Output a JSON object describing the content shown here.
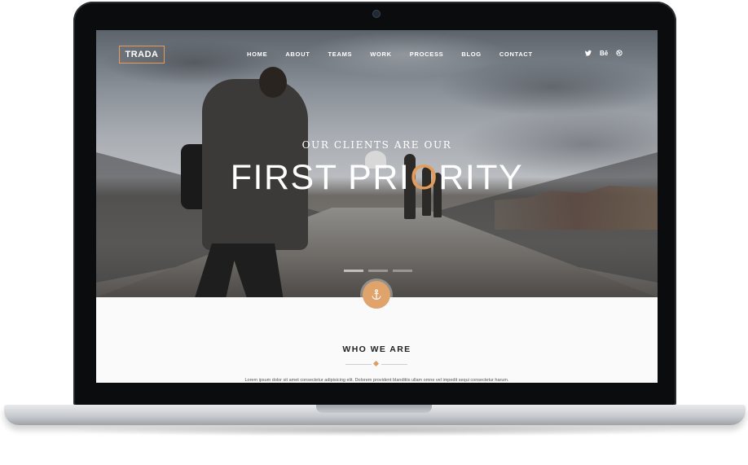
{
  "site": {
    "logo": "TRADA",
    "nav": [
      "HOME",
      "ABOUT",
      "TEAMS",
      "WORK",
      "PROCESS",
      "BLOG",
      "CONTACT"
    ],
    "social_icons": [
      "twitter-icon",
      "behance-icon",
      "dribbble-icon"
    ],
    "social_labels": {
      "behance": "Bē"
    }
  },
  "hero": {
    "subtitle": "OUR CLIENTS ARE OUR",
    "title_pre": "FIRST PRI",
    "title_o": "O",
    "title_post": "RITY",
    "slider_count": 3,
    "active_slide": 1,
    "scroll_icon": "anchor-icon"
  },
  "about": {
    "heading": "WHO WE ARE",
    "text": "Lorem ipsum dolor sit amet consectetur adipisicing elit. Dolorem provident blanditiis ullam omne vel impedit sequi consectetur harum."
  },
  "colors": {
    "accent": "#e69c53",
    "text_dark": "#222222",
    "page_bg": "#fafafa"
  }
}
